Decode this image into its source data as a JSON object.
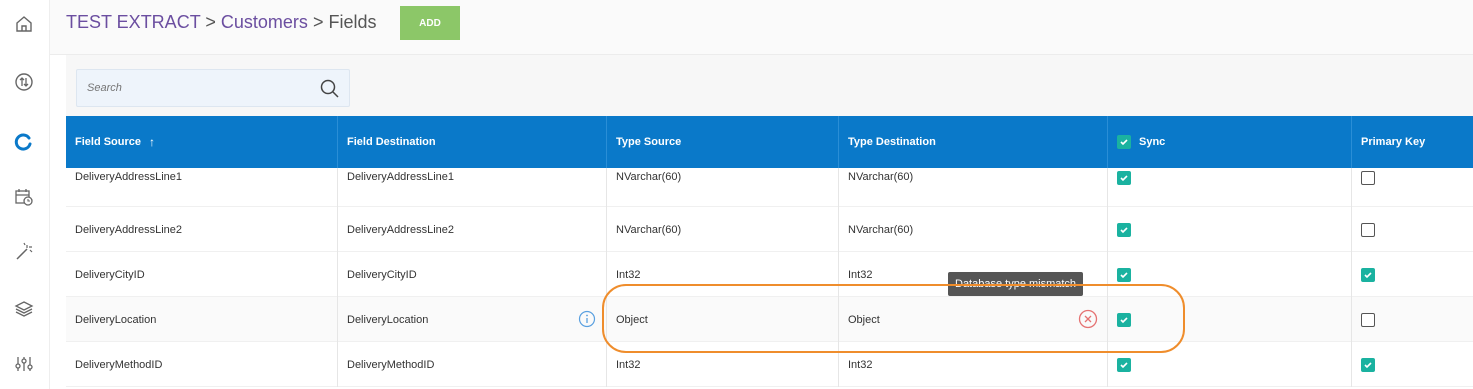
{
  "breadcrumb": {
    "project": "TEST EXTRACT",
    "separator1": ">",
    "table": "Customers",
    "separator2": ">",
    "current": "Fields"
  },
  "toolbar": {
    "add_label": "ADD"
  },
  "search": {
    "placeholder": "Search",
    "value": ""
  },
  "sidebar": {
    "items": [
      {
        "icon": "home-icon"
      },
      {
        "icon": "sync-icon"
      },
      {
        "icon": "loading-icon",
        "active": true
      },
      {
        "icon": "calendar-clock-icon"
      },
      {
        "icon": "magic-wand-icon"
      },
      {
        "icon": "layers-icon"
      },
      {
        "icon": "sliders-icon"
      }
    ]
  },
  "table": {
    "columns": [
      {
        "label": "Field Source",
        "sorted": "ascending"
      },
      {
        "label": "Field Destination"
      },
      {
        "label": "Type Source"
      },
      {
        "label": "Type Destination"
      },
      {
        "label": "Sync",
        "header_checkbox": true
      },
      {
        "label": "Primary Key"
      }
    ],
    "rows": [
      {
        "field_source": "DeliveryAddressLine1",
        "field_destination": "DeliveryAddressLine1",
        "type_source": "NVarchar(60)",
        "type_destination": "NVarchar(60)",
        "sync": true,
        "primary_key": false
      },
      {
        "field_source": "DeliveryAddressLine2",
        "field_destination": "DeliveryAddressLine2",
        "type_source": "NVarchar(60)",
        "type_destination": "NVarchar(60)",
        "sync": true,
        "primary_key": false
      },
      {
        "field_source": "DeliveryCityID",
        "field_destination": "DeliveryCityID",
        "type_source": "Int32",
        "type_destination": "Int32",
        "sync": true,
        "primary_key": true
      },
      {
        "field_source": "DeliveryLocation",
        "field_destination": "DeliveryLocation",
        "type_source": "Object",
        "type_destination": "Object",
        "sync": true,
        "primary_key": false,
        "info_icon": true,
        "error_icon": true
      },
      {
        "field_source": "DeliveryMethodID",
        "field_destination": "DeliveryMethodID",
        "type_source": "Int32",
        "type_destination": "Int32",
        "sync": true,
        "primary_key": true
      }
    ]
  },
  "tooltip": {
    "text": "Database type mismatch"
  },
  "colors": {
    "header_blue": "#0a79c9",
    "checkbox_teal": "#1ab2a0",
    "add_green": "#8cc768",
    "highlight_orange": "#ef8d2c",
    "error_red": "#e57373",
    "breadcrumb_purple": "#6b4ea0"
  }
}
